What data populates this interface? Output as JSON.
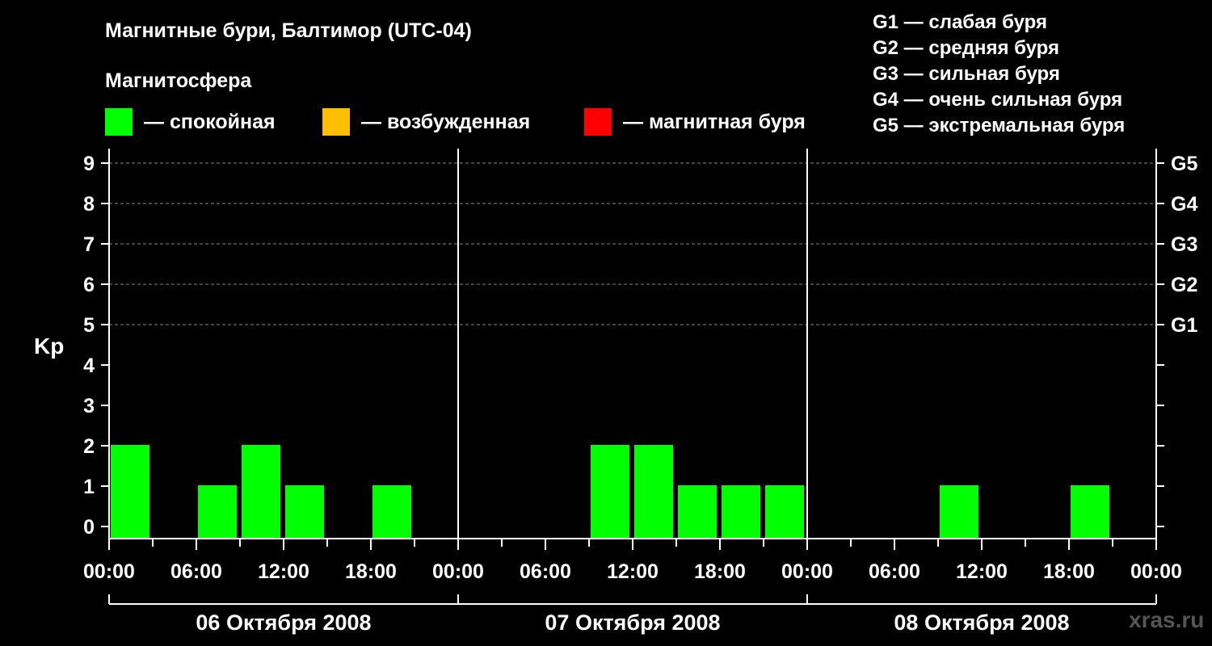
{
  "title": "Магнитные бури, Балтимор (UTC-04)",
  "subtitle": "Магнитосфера",
  "legend": [
    {
      "label": "— спокойная",
      "color": "#00ff00"
    },
    {
      "label": "— возбужденная",
      "color": "#ffbf00"
    },
    {
      "label": "— магнитная буря",
      "color": "#ff0000"
    }
  ],
  "g_levels": [
    "G1 — слабая буря",
    "G2 — средняя буря",
    "G3 — сильная буря",
    "G4 — очень сильная буря",
    "G5 — экстремальная буря"
  ],
  "site": "xras.ru",
  "chart_data": {
    "type": "bar",
    "ylabel": "Kp",
    "ylim": [
      0,
      9
    ],
    "yticks": [
      0,
      1,
      2,
      3,
      4,
      5,
      6,
      7,
      8,
      9
    ],
    "right_ticks": [
      {
        "value": 5,
        "label": "G1"
      },
      {
        "value": 6,
        "label": "G2"
      },
      {
        "value": 7,
        "label": "G3"
      },
      {
        "value": 8,
        "label": "G4"
      },
      {
        "value": 9,
        "label": "G5"
      }
    ],
    "xtick_labels": [
      "00:00",
      "06:00",
      "12:00",
      "18:00",
      "00:00",
      "06:00",
      "12:00",
      "18:00",
      "00:00",
      "06:00",
      "12:00",
      "18:00",
      "00:00"
    ],
    "days": [
      "06 Октября 2008",
      "07 Октября 2008",
      "08 Октября 2008"
    ],
    "interval_hours": 3,
    "grid": true,
    "series": [
      {
        "values": [
          2,
          0,
          1,
          2,
          1,
          0,
          1,
          0,
          0,
          0,
          0,
          2,
          2,
          1,
          1,
          1,
          0,
          0,
          0,
          1,
          0,
          0,
          1,
          0
        ]
      }
    ]
  }
}
